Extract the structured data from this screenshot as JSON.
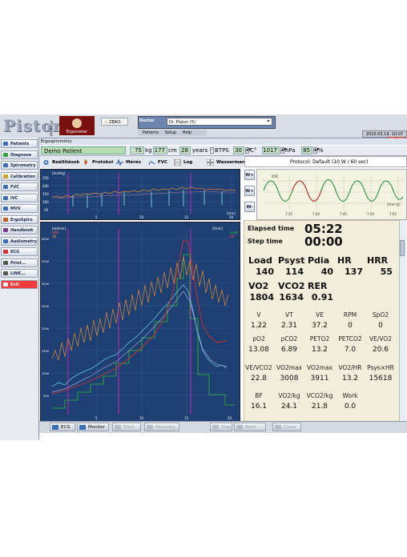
{
  "app": {
    "logo": "Piston",
    "logo_sub": "Medical",
    "badge": "Ergometer",
    "zero_label": "ZERO",
    "doctor_label": "Doctor",
    "doctor_value": "Dr. Platon (5)",
    "menu": [
      "Patients",
      "Setup",
      "Help"
    ],
    "datetime": "2010.03.19. 10:07",
    "close": "X"
  },
  "sidebar": {
    "items": [
      {
        "label": "Patients",
        "icon": "patients-icon"
      },
      {
        "label": "Diagnose",
        "icon": "diagnose-icon"
      },
      {
        "label": "Spirometry",
        "icon": "spirometry-icon"
      },
      {
        "label": "Calibration",
        "icon": "calibration-icon"
      },
      {
        "label": "FVC",
        "icon": "fvc-icon"
      },
      {
        "label": "IVC",
        "icon": "ivc-icon"
      },
      {
        "label": "MVV",
        "icon": "mvv-icon"
      },
      {
        "label": "ErgoSpiro",
        "icon": "ergospiro-icon"
      },
      {
        "label": "Handbook",
        "icon": "handbook-icon"
      },
      {
        "label": "Audiometry",
        "icon": "audiometry-icon"
      },
      {
        "label": "ECG",
        "icon": "ecg-icon"
      },
      {
        "label": "Print...",
        "icon": "print-icon"
      },
      {
        "label": "LINK...",
        "icon": "link-icon"
      },
      {
        "label": "Exit",
        "icon": "exit-icon"
      }
    ]
  },
  "module_title": "Ergospirometry",
  "patient": {
    "name": "Demo Patient",
    "weight": "75",
    "weight_unit": "kg",
    "height": "177",
    "height_unit": "cm",
    "age": "28",
    "age_unit": "years",
    "btps_label": "BTPS",
    "temp": "30",
    "temp_unit": "C°",
    "pressure": "1017",
    "pressure_unit": "hPa",
    "humidity": "85",
    "humidity_unit": "%"
  },
  "tabs": [
    {
      "label": "Beállítások",
      "icon": "settings-icon"
    },
    {
      "label": "Protokol",
      "icon": "protocol-icon"
    },
    {
      "label": "Mérés",
      "icon": "measure-icon"
    },
    {
      "label": "FVC",
      "icon": "fvc-loop-icon"
    },
    {
      "label": "Log",
      "icon": "log-icon"
    },
    {
      "label": "Wasserman",
      "icon": "wasserman-icon"
    }
  ],
  "protocol": "Protocol: Default (10 W / 60 sec)",
  "wave_buttons": [
    "W+",
    "W+",
    "W-"
  ],
  "bp_chart": {
    "unit_left": "[mmHg]",
    "unit_right": "[min]",
    "yticks": [
      "250",
      "200",
      "150",
      "100",
      "50"
    ],
    "xticks": [
      "5",
      "10",
      "15",
      "20"
    ]
  },
  "main_chart": {
    "unit_left": "[ml/min]",
    "unit_right": "[l/min]",
    "legend_left": [
      "HRR",
      "VE"
    ],
    "legend_right": [
      "Load",
      "HR"
    ],
    "yticks_left": [
      "4000",
      "3500",
      "3000",
      "2500",
      "2000",
      "1500",
      "1000",
      "500"
    ],
    "xticks": [
      "5",
      "10",
      "15",
      "20"
    ]
  },
  "wave_chart": {
    "ylabel": "450",
    "unit": "[mm:ss]",
    "xticks": [
      "7:35",
      "7:40",
      "7:45",
      "7:50",
      "7:55"
    ]
  },
  "timers": {
    "elapsed_label": "Elapsed time",
    "elapsed_value": "05:22",
    "step_label": "Step time",
    "step_value": "00:00"
  },
  "big_metrics": [
    {
      "label": "Load",
      "value": "140"
    },
    {
      "label": "Psyst",
      "value": "114"
    },
    {
      "label": "Pdia",
      "value": "40"
    },
    {
      "label": "HR",
      "value": "137"
    },
    {
      "label": "HRR",
      "value": "55"
    },
    {
      "label": "VO2",
      "value": "1804"
    },
    {
      "label": "VCO2",
      "value": "1634"
    },
    {
      "label": "RER",
      "value": "0.91"
    }
  ],
  "small_metrics": [
    {
      "label": "V",
      "value": "1.22"
    },
    {
      "label": "VT",
      "value": "2.31"
    },
    {
      "label": "VE",
      "value": "37.2"
    },
    {
      "label": "RPM",
      "value": "0"
    },
    {
      "label": "SpO2",
      "value": "0"
    },
    {
      "label": "pO2",
      "value": "13.08"
    },
    {
      "label": "pCO2",
      "value": "6.89"
    },
    {
      "label": "PETO2",
      "value": "13.2"
    },
    {
      "label": "PETCO2",
      "value": "7.0"
    },
    {
      "label": "VE/VO2",
      "value": "20.6"
    },
    {
      "label": "VE/VCO2",
      "value": "22.8"
    },
    {
      "label": "VO2max",
      "value": "3008"
    },
    {
      "label": "VO2max",
      "value": "3911"
    },
    {
      "label": "VO2/HR",
      "value": "13.2"
    },
    {
      "label": "Psys×HR",
      "value": "15618"
    },
    {
      "label": "BF",
      "value": "16.1"
    },
    {
      "label": "VO2/kg",
      "value": "24.1"
    },
    {
      "label": "VCO2/kg",
      "value": "21.8"
    },
    {
      "label": "Work",
      "value": "0.0"
    }
  ],
  "bottom_buttons": [
    {
      "label": "ECG",
      "enabled": true
    },
    {
      "label": "Monitor",
      "enabled": true
    },
    {
      "label": "Start",
      "enabled": false
    },
    {
      "label": "Recovery",
      "enabled": false
    },
    {
      "label": "Stop",
      "enabled": false
    },
    {
      "label": "Mark",
      "enabled": false
    },
    {
      "label": "Close",
      "enabled": false
    }
  ],
  "colors": {
    "chart_bg": "#1d3f72",
    "exit_red": "#ee3b3b",
    "patient_green": "#b9dcb0",
    "panel_bg": "#f2eedb"
  }
}
